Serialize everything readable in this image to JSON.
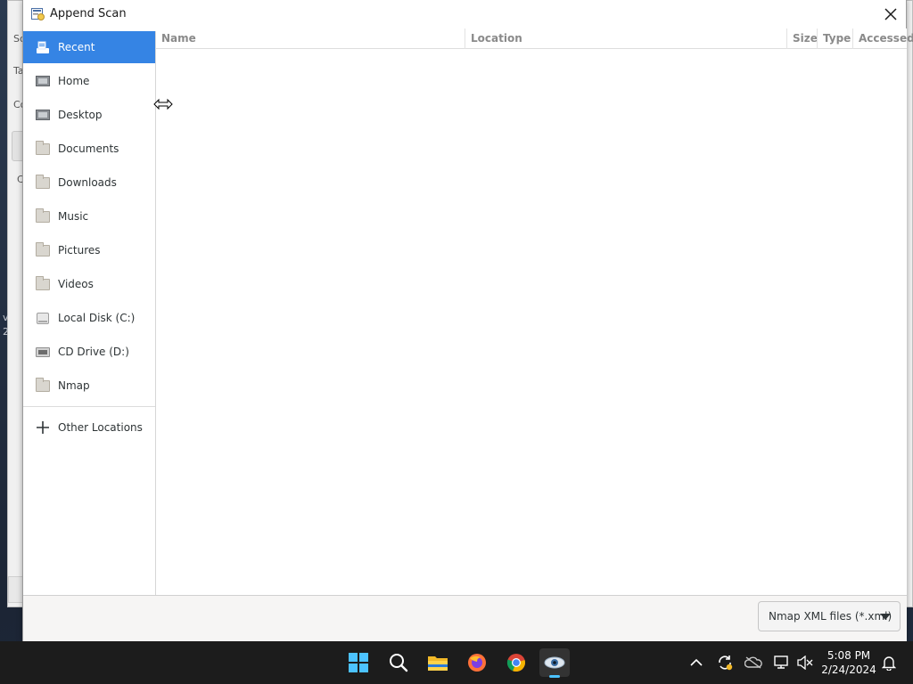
{
  "dialog": {
    "title": "Append Scan",
    "close_icon": "close-icon"
  },
  "sidebar": {
    "items": [
      {
        "label": "Recent",
        "icon": "recent-icon",
        "selected": true
      },
      {
        "label": "Home",
        "icon": "home-icon"
      },
      {
        "label": "Desktop",
        "icon": "desktop-icon"
      },
      {
        "label": "Documents",
        "icon": "folder-icon"
      },
      {
        "label": "Downloads",
        "icon": "folder-icon"
      },
      {
        "label": "Music",
        "icon": "folder-icon"
      },
      {
        "label": "Pictures",
        "icon": "folder-icon"
      },
      {
        "label": "Videos",
        "icon": "folder-icon"
      },
      {
        "label": "Local Disk (C:)",
        "icon": "drive-icon"
      },
      {
        "label": "CD Drive (D:)",
        "icon": "cd-drive-icon"
      },
      {
        "label": "Nmap",
        "icon": "folder-icon"
      }
    ],
    "other_locations": "Other Locations"
  },
  "filelist": {
    "columns": [
      "Name",
      "Location",
      "Size",
      "Type",
      "Accessed"
    ],
    "rows": []
  },
  "footer": {
    "filter": "Nmap XML files (*.xml)"
  },
  "taskbar": {
    "apps": [
      "start-icon",
      "search-icon",
      "file-explorer-icon",
      "firefox-icon",
      "chrome-icon",
      "zenmap-icon"
    ],
    "tray": [
      "chevron-up-icon",
      "sync-icon",
      "onedrive-icon",
      "network-icon",
      "volume-muted-icon",
      "notification-bell-icon"
    ],
    "time": "5:08 PM",
    "date": "2/24/2024"
  },
  "colors": {
    "selection": "#3584e4",
    "taskbar": "#1c1c1c",
    "accent_indicator": "#4cc2ff"
  }
}
